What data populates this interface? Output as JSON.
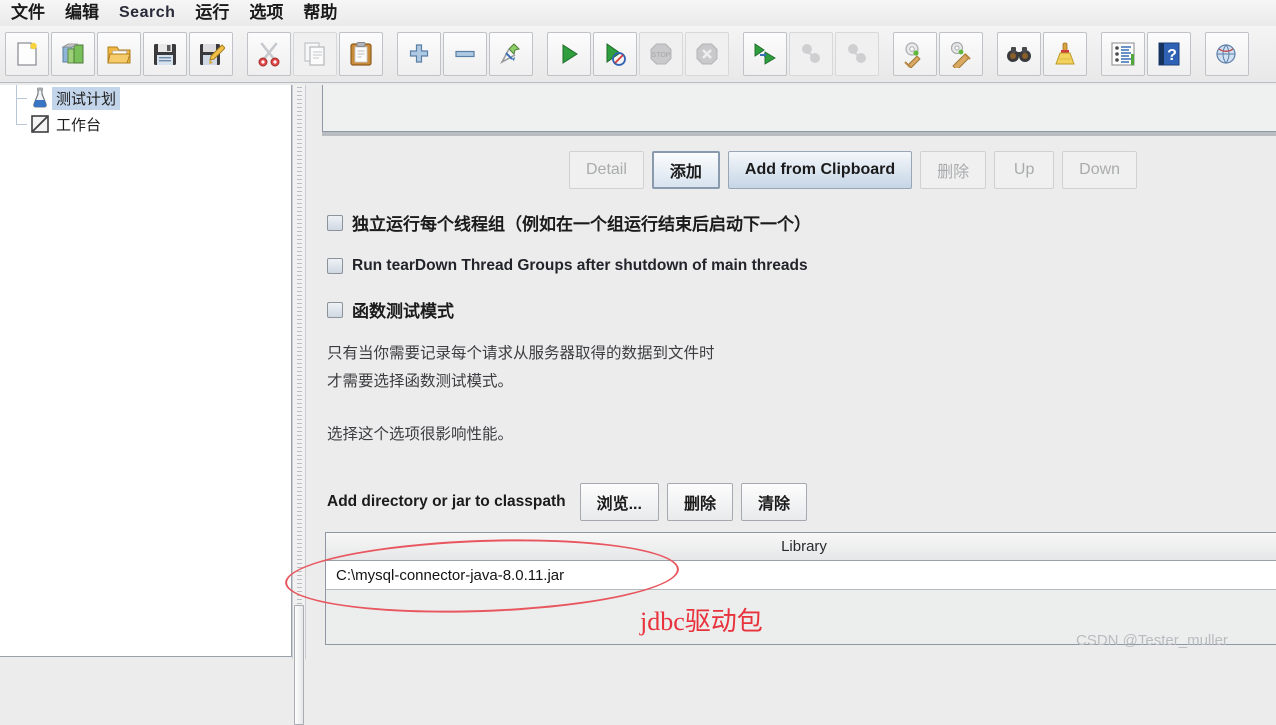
{
  "menu": {
    "items": [
      {
        "label": "文件",
        "latin": false
      },
      {
        "label": "编辑",
        "latin": false
      },
      {
        "label": "Search",
        "latin": true
      },
      {
        "label": "运行",
        "latin": false
      },
      {
        "label": "选项",
        "latin": false
      },
      {
        "label": "帮助",
        "latin": false
      }
    ]
  },
  "toolbar": {
    "buttons": [
      {
        "icon": "new-document-icon",
        "enabled": true
      },
      {
        "icon": "open-templates-icon",
        "enabled": true
      },
      {
        "icon": "open-folder-icon",
        "enabled": true
      },
      {
        "icon": "save-floppy-icon",
        "enabled": true
      },
      {
        "icon": "save-as-floppy-pencil-icon",
        "enabled": true
      },
      {
        "icon": "separator",
        "enabled": true
      },
      {
        "icon": "cut-scissors-icon",
        "enabled": true
      },
      {
        "icon": "copy-pages-icon",
        "enabled": true
      },
      {
        "icon": "paste-clipboard-icon",
        "enabled": true
      },
      {
        "icon": "separator",
        "enabled": true
      },
      {
        "icon": "expand-plus-icon",
        "enabled": true
      },
      {
        "icon": "collapse-minus-icon",
        "enabled": true
      },
      {
        "icon": "toggle-pin-icon",
        "enabled": true
      },
      {
        "icon": "separator",
        "enabled": true
      },
      {
        "icon": "start-play-icon",
        "enabled": true
      },
      {
        "icon": "start-no-pauses-icon",
        "enabled": true
      },
      {
        "icon": "stop-icon",
        "enabled": false
      },
      {
        "icon": "shutdown-icon",
        "enabled": false
      },
      {
        "icon": "separator",
        "enabled": true
      },
      {
        "icon": "remote-start-all-icon",
        "enabled": true
      },
      {
        "icon": "remote-stop-all-icon",
        "enabled": false
      },
      {
        "icon": "remote-shutdown-all-icon",
        "enabled": false
      },
      {
        "icon": "separator",
        "enabled": true
      },
      {
        "icon": "clear-gear-broom-icon",
        "enabled": true
      },
      {
        "icon": "clear-all-gear-broom-icon",
        "enabled": true
      },
      {
        "icon": "separator",
        "enabled": true
      },
      {
        "icon": "search-binoculars-icon",
        "enabled": true
      },
      {
        "icon": "reset-search-broom-icon",
        "enabled": true
      },
      {
        "icon": "separator",
        "enabled": true
      },
      {
        "icon": "function-helper-list-icon",
        "enabled": true
      },
      {
        "icon": "help-book-icon",
        "enabled": true
      },
      {
        "icon": "separator",
        "enabled": true
      },
      {
        "icon": "templates-globe-icon",
        "enabled": true
      }
    ]
  },
  "tree": {
    "items": [
      {
        "label": "测试计划",
        "icon": "test-plan-flask-icon",
        "selected": true
      },
      {
        "label": "工作台",
        "icon": "workbench-icon",
        "selected": false
      }
    ]
  },
  "panel": {
    "buttons": [
      {
        "label": "Detail",
        "state": "disabled"
      },
      {
        "label": "添加",
        "state": "focused"
      },
      {
        "label": "Add from Clipboard",
        "state": "accent"
      },
      {
        "label": "删除",
        "state": "disabled"
      },
      {
        "label": "Up",
        "state": "disabled"
      },
      {
        "label": "Down",
        "state": "disabled"
      }
    ],
    "checkboxes": [
      {
        "label": "独立运行每个线程组（例如在一个组运行结束后启动下一个）",
        "checked": false,
        "latin": false
      },
      {
        "label": "Run tearDown Thread Groups after shutdown of main threads",
        "checked": false,
        "latin": true
      },
      {
        "label": "函数测试模式",
        "checked": false,
        "latin": false
      }
    ],
    "description": [
      "只有当你需要记录每个请求从服务器取得的数据到文件时",
      "才需要选择函数测试模式。",
      "选择这个选项很影响性能。"
    ],
    "classpath": {
      "label": "Add directory or jar to classpath",
      "buttons": [
        {
          "label": "浏览..."
        },
        {
          "label": "删除"
        },
        {
          "label": "清除"
        }
      ]
    },
    "library_table": {
      "header": "Library",
      "rows": [
        "C:\\mysql-connector-java-8.0.11.jar"
      ]
    }
  },
  "annotations": {
    "red_note": "jdbc驱动包",
    "watermark": "CSDN @Tester_muller",
    "highlight_color": "#e8575f"
  }
}
